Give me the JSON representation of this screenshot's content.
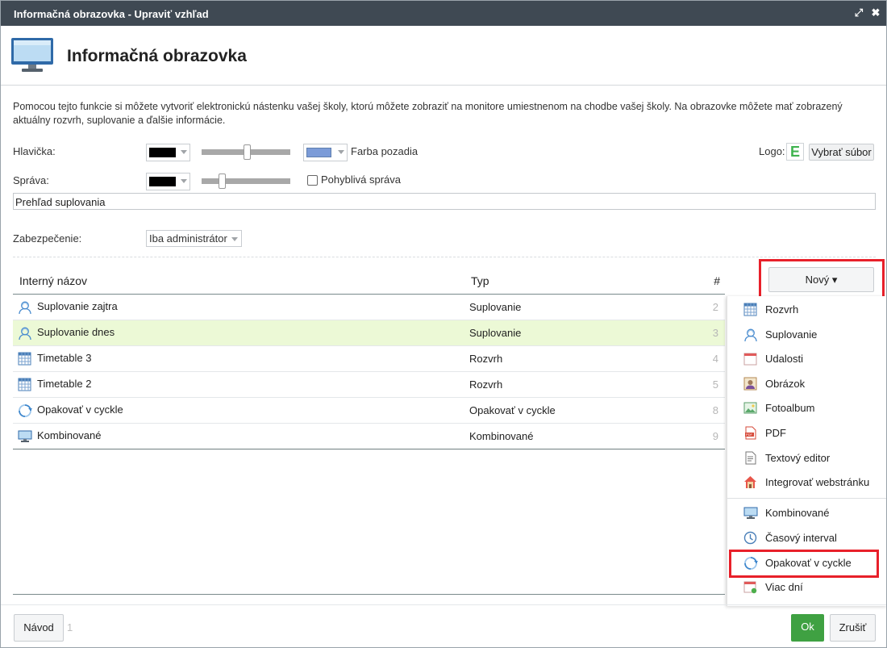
{
  "window": {
    "title": "Informačná obrazovka - Upraviť vzhľad",
    "maximize_glyph": "⤢",
    "close_glyph": "✖"
  },
  "header": {
    "icon": "monitor-icon",
    "title": "Informačná obrazovka"
  },
  "description": "Pomocou tejto funkcie si môžete vytvoriť elektronickú nástenku vašej školy, ktorú môžete zobraziť na monitore umiestnenom na chodbe vašej školy. Na obrazovke môžete mať zobrazený aktuálny rozvrh, suplovanie a ďalšie informácie.",
  "settings": {
    "header_label": "Hlavička:",
    "header_text_color": "#000000",
    "header_bg_color": "#7b9bd8",
    "header_slider_value": 0.51,
    "background_label": "Farba pozadia",
    "logo_label": "Logo:",
    "logo_letter": "E",
    "logo_color": "#3fb34f",
    "choose_file_label": "Vybrať súbor",
    "message_label": "Správa:",
    "message_text_color": "#000000",
    "message_slider_value": 0.21,
    "moving_message_label": "Pohyblivá správa",
    "moving_message_checked": false,
    "message_text": "Prehľad suplovania",
    "security_label": "Zabezpečenie:",
    "security_value": "Iba administrátor"
  },
  "table": {
    "columns": {
      "name": "Interný názov",
      "type": "Typ",
      "num": "#"
    },
    "rows": [
      {
        "icon": "substitution-icon",
        "name": "Suplovanie zajtra",
        "type": "Suplovanie",
        "num": "2",
        "selected": false
      },
      {
        "icon": "substitution-icon",
        "name": "Suplovanie dnes",
        "type": "Suplovanie",
        "num": "3",
        "selected": true
      },
      {
        "icon": "timetable-icon",
        "name": "Timetable 3",
        "type": "Rozvrh",
        "num": "4",
        "selected": false
      },
      {
        "icon": "timetable-icon",
        "name": "Timetable 2",
        "type": "Rozvrh",
        "num": "5",
        "selected": false
      },
      {
        "icon": "repeat-cycle-icon",
        "name": "Opakovať v cyckle",
        "type": "Opakovať v cyckle",
        "num": "8",
        "selected": false
      },
      {
        "icon": "monitor-icon",
        "name": "Kombinované",
        "type": "Kombinované",
        "num": "9",
        "selected": false
      }
    ]
  },
  "new_button": {
    "label": "Nový ▾"
  },
  "dropdown_menu": {
    "items": [
      {
        "icon": "timetable-icon",
        "label": "Rozvrh"
      },
      {
        "icon": "substitution-icon",
        "label": "Suplovanie"
      },
      {
        "icon": "calendar-icon",
        "label": "Udalosti"
      },
      {
        "icon": "picture-icon",
        "label": "Obrázok"
      },
      {
        "icon": "photo-album-icon",
        "label": "Fotoalbum"
      },
      {
        "icon": "pdf-icon",
        "label": "PDF"
      },
      {
        "icon": "text-editor-icon",
        "label": "Textový editor"
      },
      {
        "icon": "house-icon",
        "label": "Integrovať webstránku"
      },
      {
        "icon": "monitor-icon",
        "label": "Kombinované"
      },
      {
        "icon": "clock-icon",
        "label": "Časový interval"
      },
      {
        "icon": "repeat-cycle-icon",
        "label": "Opakovať v cyckle"
      },
      {
        "icon": "multi-day-calendar-icon",
        "label": "Viac dní"
      }
    ]
  },
  "footer": {
    "help_label": "Návod",
    "help_count": "1",
    "ok_label": "Ok",
    "cancel_label": "Zrušiť"
  },
  "colors": {
    "titlebar": "#3f4953",
    "accent_red": "#e8202a",
    "ok_green": "#3fa142",
    "selected_row": "#ecf9d6"
  }
}
